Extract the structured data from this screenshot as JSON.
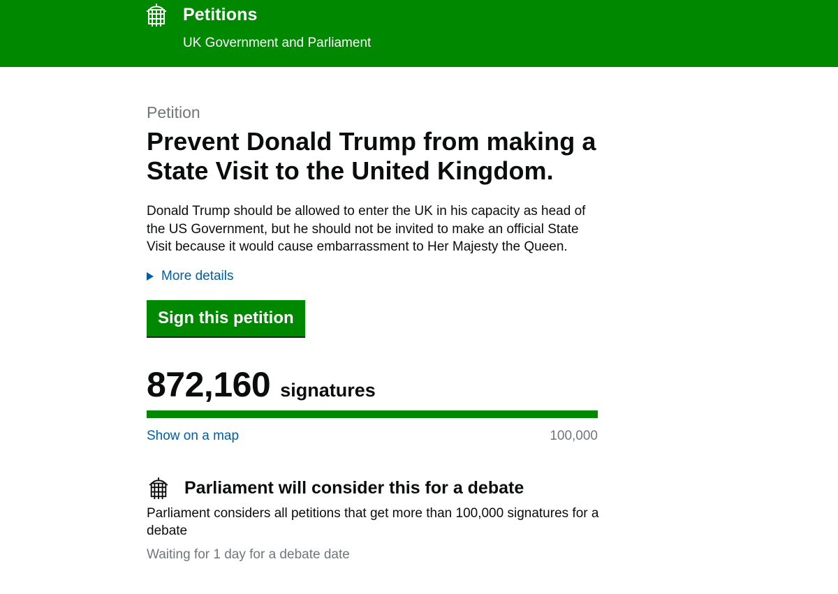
{
  "header": {
    "title": "Petitions",
    "subtitle": "UK Government and Parliament",
    "logo_icon": "portcullis-icon",
    "background_color": "#008800"
  },
  "petition": {
    "kicker": "Petition",
    "title": "Prevent Donald Trump from making a State Visit to the United Kingdom.",
    "description": "Donald Trump should be allowed to enter the UK in his capacity as head of the US Government, but he should not be invited to make an official State Visit because it would cause embarrassment to Her Majesty the Queen.",
    "more_details_label": "More details",
    "sign_button_label": "Sign this petition"
  },
  "signatures": {
    "count": "872,160",
    "label": "signatures",
    "progress_fraction": 1.0,
    "map_link_label": "Show on a map",
    "threshold": "100,000"
  },
  "debate": {
    "icon": "portcullis-icon",
    "heading": "Parliament will consider this for a debate",
    "text": "Parliament considers all petitions that get more than 100,000 signatures for a debate",
    "status": "Waiting for 1 day for a debate date"
  },
  "colors": {
    "accent_green": "#008800",
    "link_blue": "#005ea5",
    "muted_grey": "#6f777b"
  }
}
